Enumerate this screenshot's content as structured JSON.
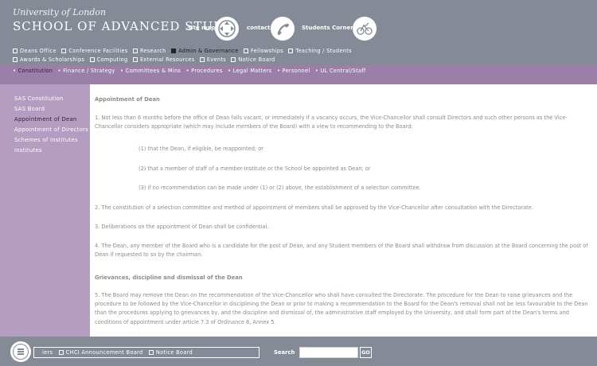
{
  "header": {
    "university": "University of London",
    "school": "SCHOOL OF ADVANCED STUDY",
    "site_map": "site map",
    "contact": "contact",
    "students_corner": "Students Corner",
    "colors": {
      "header_bg": "#848b97",
      "purple_bar": "#9b7fa9",
      "sidebar": "#b59cc1"
    }
  },
  "nav": {
    "row1": [
      "Deans Office",
      "Conference Facilities",
      "Research",
      "Admin & Governance",
      "Fellowships",
      "Teaching / Students"
    ],
    "row2": [
      "Awards & Scholarships",
      "Computing",
      "External Resources",
      "Events",
      "Notice Board"
    ],
    "active": "Admin & Governance"
  },
  "subnav": {
    "items": [
      "Constitution",
      "Finance / Strategy",
      "Committees & Mins",
      "Procedures",
      "Legal Matters",
      "Personnel",
      "UL Central/Staff"
    ],
    "active": "Constitution"
  },
  "sidebar": {
    "items": [
      "SAS Constitution",
      "SAS Board",
      "Appointment of Dean",
      "Appointment of Directors",
      "Schemes of Institutes",
      "Institutes"
    ],
    "active": "Appointment of Dean"
  },
  "content": {
    "heading1": "Appointment of Dean",
    "p1": "1. Not less than 6 months before the office of Dean falls vacant, or immediately if a vacancy occurs, the Vice-Chancellor shall consult Directors and such other persons as the Vice-Chancellor considers appropriate (which may include members of the Board) with a view to recommending to the Board:",
    "opt1": "(1) that the Dean, if eligible, be reappointed; or",
    "opt2": "(2) that a member of staff of a member-Institute or the School be appointed as Dean; or",
    "opt3": "(3) if no recommendation can be made under (1) or (2) above, the establishment of a selection committee.",
    "p2": "2. The constitution of a selection committee and method of appointment of members shall be approved by the Vice-Chancellor after consultation with the Directorate.",
    "p3": "3. Deliberations on the appointment of Dean shall be confidential.",
    "p4": "4. The Dean, any member of the Board who is a candidate for the post of Dean, and any Student members of the Board shall withdraw from discussion at the Board concerning the post of Dean if requested to so by the chairman.",
    "heading2": "Grievances, discipline and dismissal of the Dean",
    "p5": "5. The Board may remove the Dean on the recommendation of the Vice-Chancellor who shall have consulted the Directorate. The procedure for the Dean to raise grievances and the procedure to be followed by the Vice-Chancellor in disciplining the Dean or prior to making a recommendation to the Board for the Dean's removal shall not be less favourable to the Dean than the procedures applying to grievances by, and the discipline and dismissal of, the administrative staff employed by the University, and shall form part of the Dean's terms and conditions of appointment under article 7.3 of Ordinance 8, Annex 5."
  },
  "footer": {
    "items": [
      "iers",
      "CHCI Announcement Board",
      "Notice Board"
    ],
    "search_label": "Search",
    "search_value": "",
    "go_label": "GO"
  },
  "icons": {
    "site_map": "directional-pad-icon",
    "contact": "telephone-icon",
    "students_corner": "bicycle-icon",
    "menu": "menu-lines-icon"
  }
}
